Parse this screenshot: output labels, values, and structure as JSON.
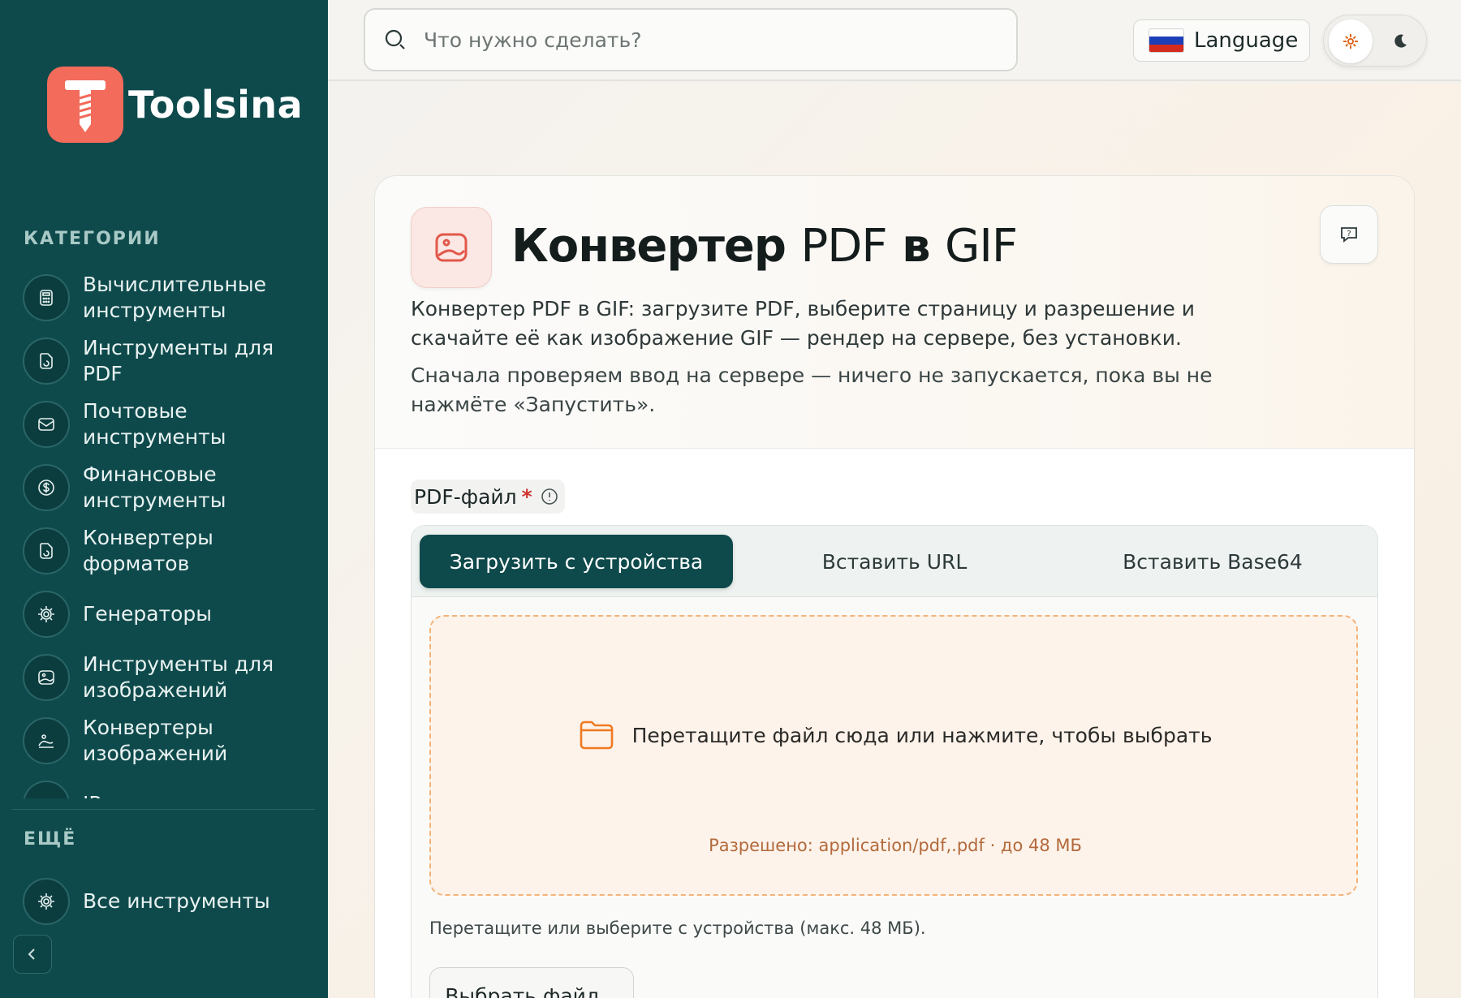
{
  "brand": {
    "name": "Toolsina",
    "accent": "#f26b5b",
    "sidebar_bg": "#0e4a4c"
  },
  "sidebar": {
    "categories_heading": "КАТЕГОРИИ",
    "items": [
      {
        "label": "Вычислительные инструменты",
        "icon": "calculator-icon"
      },
      {
        "label": "Инструменты для PDF",
        "icon": "file-icon"
      },
      {
        "label": "Почтовые инструменты",
        "icon": "mail-icon"
      },
      {
        "label": "Финансовые инструменты",
        "icon": "dollar-icon"
      },
      {
        "label": "Конвертеры форматов",
        "icon": "file-convert-icon"
      },
      {
        "label": "Генераторы",
        "icon": "cog-icon"
      },
      {
        "label": "Инструменты для изображений",
        "icon": "image-icon"
      },
      {
        "label": "Конвертеры изображений",
        "icon": "image-convert-icon"
      },
      {
        "label": "IP-инструменты",
        "icon": "network-icon"
      }
    ],
    "more_heading": "ЕЩЁ",
    "all_tools": "Все инструменты"
  },
  "topbar": {
    "search_placeholder": "Что нужно сделать?",
    "language_label": "Language"
  },
  "tool": {
    "title_bold": "Конвертер",
    "title_rest_a": "PDF",
    "title_bold_b": "в",
    "title_rest_b": "GIF",
    "description": "Конвертер PDF в GIF: загрузите PDF, выберите страницу и разрешение и скачайте её как изображение GIF — рендер на сервере, без установки.",
    "note": "Сначала проверяем ввод на сервере — ничего не запускается, пока вы не нажмёте «Запустить»."
  },
  "form": {
    "field_label": "PDF-файл",
    "required_mark": "*",
    "tabs": [
      {
        "label": "Загрузить с устройства",
        "active": true
      },
      {
        "label": "Вставить URL",
        "active": false
      },
      {
        "label": "Вставить Base64",
        "active": false
      }
    ],
    "drop_text": "Перетащите файл сюда или нажмите, чтобы выбрать",
    "allowed": "Разрешено: application/pdf,.pdf · до 48 МБ",
    "hint": "Перетащите или выберите с устройства (макс. 48 МБ).",
    "choose_button": "Выбрать файл..."
  }
}
